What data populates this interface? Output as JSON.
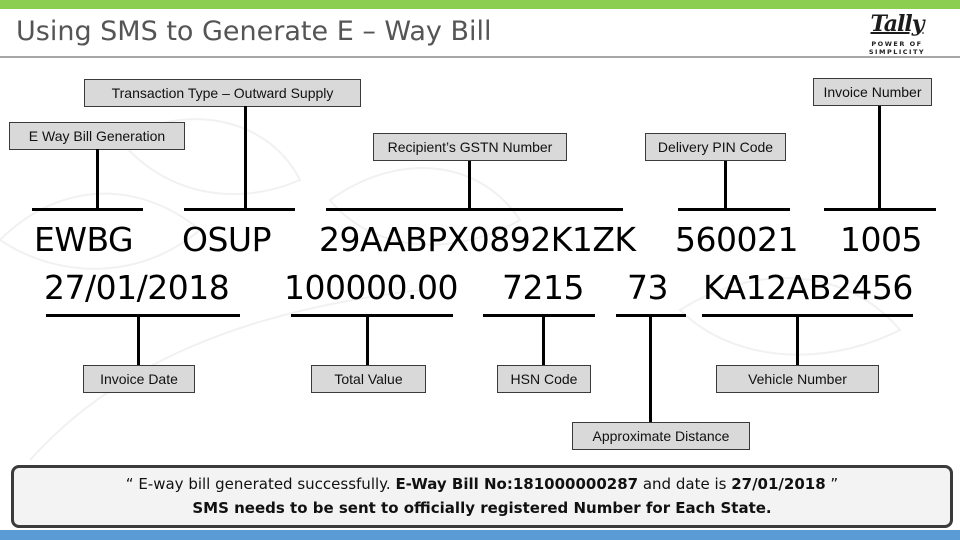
{
  "slide": {
    "title": "Using SMS to Generate E – Way Bill",
    "logo": {
      "word": "Tally",
      "tagline": "POWER OF SIMPLICITY"
    },
    "accent_colors": {
      "top_bar": "#8ccf50",
      "bottom_bar": "#5b9bd5",
      "label_fill": "#d9d9d9"
    }
  },
  "labels_top": {
    "transaction_type": "Transaction Type – Outward Supply",
    "eway_bill_generation": "E Way Bill Generation",
    "recipient_gstn": "Recipient’s GSTN Number",
    "delivery_pin": "Delivery PIN Code",
    "invoice_number": "Invoice Number"
  },
  "sms_values": {
    "row1": {
      "command": "EWBG",
      "transaction_type": "OSUP",
      "recipient_gstn": "29AABPX0892K1ZK",
      "delivery_pin": "560021",
      "invoice_number": "1005"
    },
    "row2": {
      "invoice_date": "27/01/2018",
      "total_value": "100000.00",
      "hsn_code": "7215",
      "approx_distance": "73",
      "vehicle_number": "KA12AB2456"
    }
  },
  "labels_bottom": {
    "invoice_date": "Invoice Date",
    "total_value": "Total Value",
    "hsn_code": "HSN Code",
    "vehicle_number": "Vehicle Number",
    "approx_distance": "Approximate Distance"
  },
  "response": {
    "open_quote": "“ E-way bill generated successfully.  ",
    "ewb_label": "E-Way Bill No:181000000287",
    "mid_text": " and date is ",
    "date": "27/01/2018",
    "close_quote": " ”",
    "note": "SMS needs to be sent to officially registered Number for Each State."
  }
}
